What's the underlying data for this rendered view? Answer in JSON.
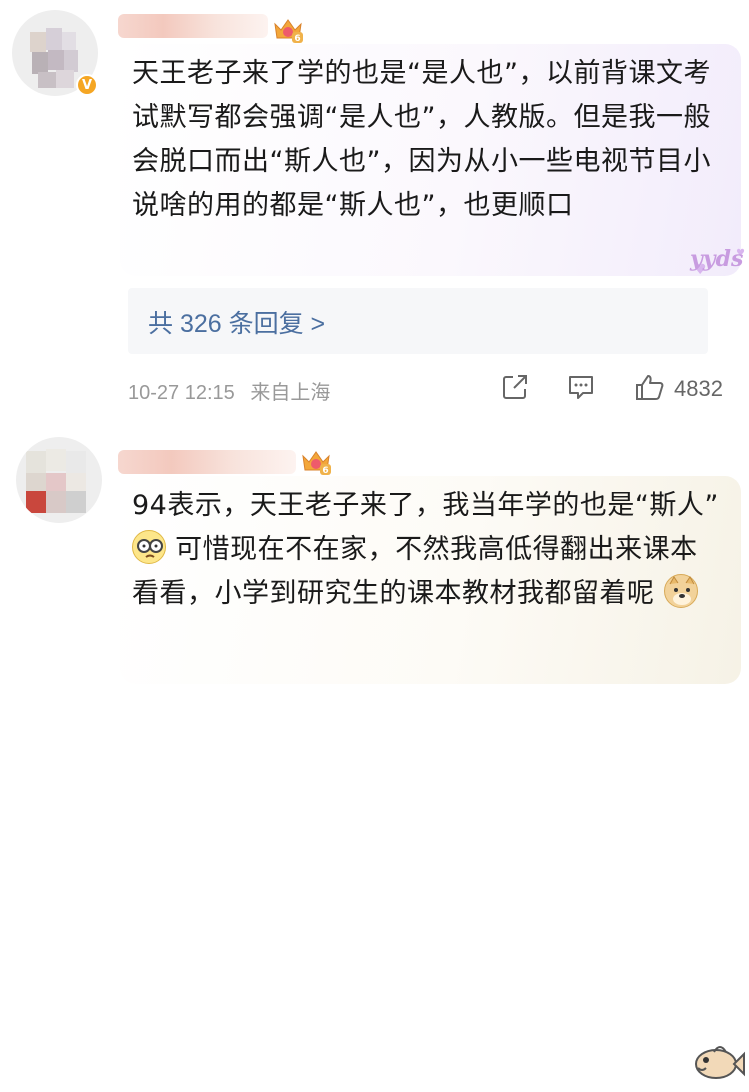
{
  "comments": [
    {
      "username": "",
      "text_parts": [
        "天王老子来了学的也是“是人也”，以前背课文考试默写都会强调“是人也”，人教版。但是我一般会脱口而出“斯人也”，因为从小一些电视节目小说啥的用的都是“斯人也”，也更顺口"
      ],
      "sticker_text": "yyds",
      "replies_label": "共 326 条回复 >",
      "time": "10-27 12:15",
      "source": "来自上海",
      "likes": "4832",
      "verified_badge": "V",
      "level": "6"
    },
    {
      "username": "",
      "text_parts": [
        "94表示，天王老子来了，我当年学的也是“斯人”",
        "可惜现在不在家，不然我高低得翻出来课本看看，小学到研究生的课本教材我都留着呢",
        ""
      ],
      "level": "6"
    }
  ],
  "icons": {
    "share": "share-icon",
    "comment": "comment-icon",
    "like": "thumbs-up-icon",
    "crown": "crown-level-icon",
    "emoji1": "glasses-face-emoji",
    "emoji2": "doge-emoji",
    "sticker2": "fish-sticker"
  },
  "colors": {
    "link": "#4b6fa0",
    "meta": "#999999",
    "badge": "#f5a623"
  }
}
